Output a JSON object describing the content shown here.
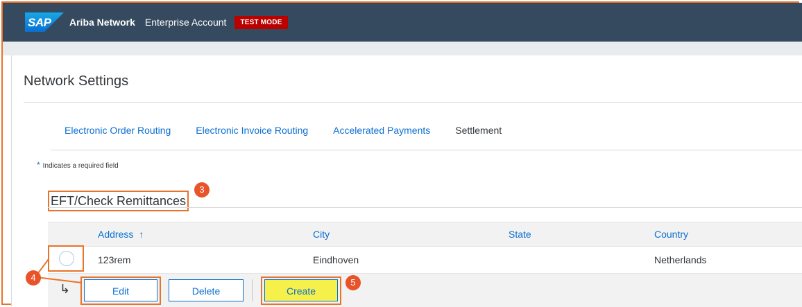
{
  "header": {
    "logo_text": "SAP",
    "brand": "Ariba Network",
    "account": "Enterprise Account",
    "test_mode": "TEST MODE"
  },
  "page": {
    "title": "Network Settings",
    "required_note": "Indicates a required field",
    "required_star": "*",
    "section_title": "EFT/Check Remittances"
  },
  "tabs": [
    {
      "label": "Electronic Order Routing"
    },
    {
      "label": "Electronic Invoice Routing"
    },
    {
      "label": "Accelerated Payments"
    },
    {
      "label": "Settlement"
    }
  ],
  "table": {
    "columns": [
      "Address",
      "City",
      "State",
      "Country"
    ],
    "sort_indicator": "↑",
    "rows": [
      {
        "address": "123rem",
        "city": "Eindhoven",
        "state": "",
        "country": "Netherlands"
      }
    ]
  },
  "actions": {
    "edit": "Edit",
    "delete": "Delete",
    "create": "Create",
    "row_arrow": "↳"
  },
  "annotations": {
    "step3": "3",
    "step4": "4",
    "step5": "5"
  },
  "colors": {
    "header_bg": "#354a5f",
    "accent": "#0a6ed1",
    "test_mode_bg": "#bb0000",
    "annotation": "#e8532a",
    "highlight": "#f5f04a"
  }
}
